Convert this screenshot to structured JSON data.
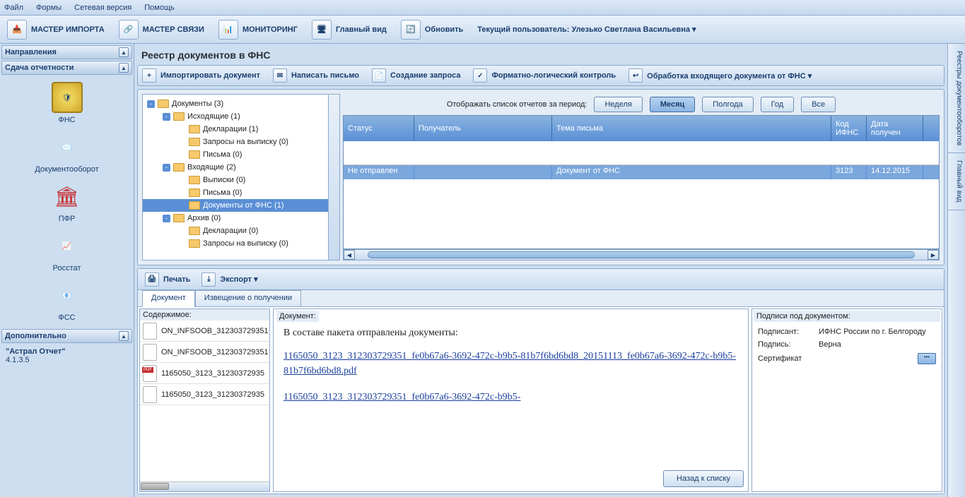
{
  "menu": [
    "Файл",
    "Формы",
    "Сетевая версия",
    "Помощь"
  ],
  "toolbar": [
    {
      "label": "МАСТЕР ИМПОРТА"
    },
    {
      "label": "МАСТЕР СВЯЗИ"
    },
    {
      "label": "МОНИТОРИНГ"
    },
    {
      "label": "Главный вид"
    },
    {
      "label": "Обновить"
    },
    {
      "label": "Текущий пользователь: Улезько Светлана Васильевна ▾"
    }
  ],
  "left": {
    "directions": "Направления",
    "report_header": "Сдача отчетности",
    "items": [
      "ФНС",
      "Документооборот",
      "ПФР",
      "Росстат",
      "ФСС"
    ],
    "extra_header": "Дополнительно",
    "app_name": "\"Астрал Отчет\"",
    "app_ver": "4.1.3.5"
  },
  "page_title": "Реестр документов в ФНС",
  "actions": [
    "Импортировать документ",
    "Написать письмо",
    "Создание запроса",
    "Форматно-логический контроль",
    "Обработка входящего документа от ФНС ▾"
  ],
  "tree": [
    {
      "indent": 0,
      "exp": "-",
      "label": "Документы (3)"
    },
    {
      "indent": 1,
      "exp": "-",
      "label": "Исходящие (1)"
    },
    {
      "indent": 2,
      "exp": "",
      "label": "Декларации (1)"
    },
    {
      "indent": 2,
      "exp": "",
      "label": "Запросы на выписку (0)"
    },
    {
      "indent": 2,
      "exp": "",
      "label": "Письма (0)"
    },
    {
      "indent": 1,
      "exp": "-",
      "label": "Входящие (2)"
    },
    {
      "indent": 2,
      "exp": "",
      "label": "Выписки (0)"
    },
    {
      "indent": 2,
      "exp": "",
      "label": "Письма (0)"
    },
    {
      "indent": 2,
      "exp": "",
      "label": "Документы от ФНС (1)",
      "selected": true
    },
    {
      "indent": 1,
      "exp": "-",
      "label": "Архив (0)"
    },
    {
      "indent": 2,
      "exp": "",
      "label": "Декларации (0)"
    },
    {
      "indent": 2,
      "exp": "",
      "label": "Запросы на выписку (0)"
    }
  ],
  "filter": {
    "label": "Отображать список отчетов за период:",
    "buttons": [
      "Неделя",
      "Месяц",
      "Полгода",
      "Год",
      "Все"
    ],
    "active": "Месяц"
  },
  "grid": {
    "cols": [
      "Статус",
      "Получатель",
      "Тема письма",
      "Код ИФНС",
      "Дата получен"
    ],
    "widths": [
      100,
      195,
      395,
      50,
      80
    ],
    "row": [
      "Не отправлен",
      "",
      "Документ от ФНС",
      "3123",
      "14.12.2015"
    ]
  },
  "lower_toolbar": [
    "Печать",
    "Экспорт ▾"
  ],
  "tabs": [
    "Документ",
    "Извещение о получении"
  ],
  "contents_label": "Содержимое:",
  "files": [
    {
      "type": "doc",
      "name": "ON_INFSOOB_312303729351"
    },
    {
      "type": "doc",
      "name": "ON_INFSOOB_312303729351"
    },
    {
      "type": "pdf",
      "name": "1165050_3123_31230372935"
    },
    {
      "type": "doc",
      "name": "1165050_3123_31230372935"
    }
  ],
  "doc": {
    "label": "Документ:",
    "text": "В составе пакета отправлены документы:",
    "link1": "1165050_3123_312303729351_fe0b67a6-3692-472c-b9b5-81b7f6bd6bd8_20151113_fe0b67a6-3692-472c-b9b5-81b7f6bd6bd8.pdf",
    "link2": "1165050_3123_312303729351_fe0b67a6-3692-472c-b9b5-"
  },
  "back_btn": "Назад к списку",
  "sign": {
    "label": "Подписи под документом:",
    "signer_lbl": "Подписант:",
    "signer_val": "ИФНС России по г. Белгороду",
    "sig_lbl": "Подпись:",
    "sig_val": "Верна",
    "cert_lbl": "Сертификат"
  },
  "right_tabs": [
    "Реестры документооборотов",
    "Главный вид"
  ]
}
